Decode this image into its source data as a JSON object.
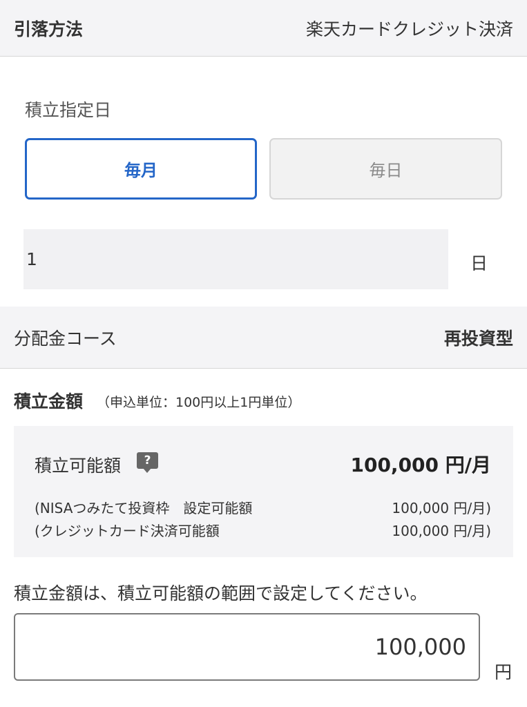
{
  "payment": {
    "label": "引落方法",
    "value": "楽天カードクレジット決済"
  },
  "schedule": {
    "label": "積立指定日",
    "options": [
      {
        "label": "毎月",
        "selected": true
      },
      {
        "label": "毎日",
        "selected": false
      }
    ],
    "day_value": "1",
    "day_unit": "日"
  },
  "distribution": {
    "label": "分配金コース",
    "value": "再投資型"
  },
  "amount": {
    "title": "積立金額",
    "note": "（申込単位：100円以上1円単位）",
    "limit_label": "積立可能額",
    "help_icon": "?",
    "limit_value": "100,000 円/月",
    "nisa_label": "(NISAつみたて投資枠　設定可能額",
    "nisa_value": "100,000 円/月)",
    "credit_label": "(クレジットカード決済可能額",
    "credit_value": "100,000 円/月)",
    "instruction": "積立金額は、積立可能額の範囲で設定してください。",
    "input_value": "100,000",
    "unit": "円"
  },
  "colors": {
    "accent": "#2466c8",
    "header_bg": "#f4f4f6"
  }
}
